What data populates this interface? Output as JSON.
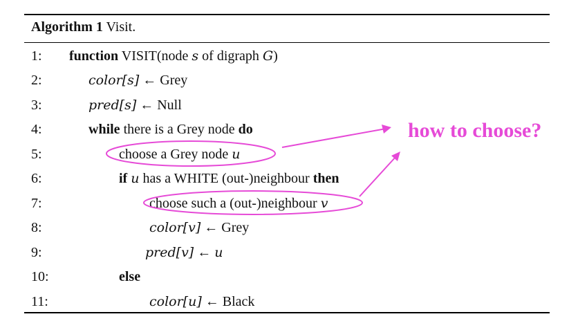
{
  "caption": {
    "label": "Algorithm 1",
    "title": "Visit."
  },
  "lines": [
    {
      "num": "1:",
      "parts": [
        {
          "t": "kw",
          "v": "function"
        },
        {
          "t": "txt",
          "v": " VISIT(node "
        },
        {
          "t": "math",
          "v": "s"
        },
        {
          "t": "txt",
          "v": " of digraph "
        },
        {
          "t": "math",
          "v": "G"
        },
        {
          "t": "txt",
          "v": ")"
        }
      ]
    },
    {
      "num": "2:",
      "parts": [
        {
          "t": "math",
          "v": "color[s]"
        },
        {
          "t": "txt",
          "v": " ← Grey"
        }
      ]
    },
    {
      "num": "3:",
      "parts": [
        {
          "t": "math",
          "v": "pred[s]"
        },
        {
          "t": "txt",
          "v": " ← Null"
        }
      ]
    },
    {
      "num": "4:",
      "parts": [
        {
          "t": "kw",
          "v": "while"
        },
        {
          "t": "txt",
          "v": " there is a Grey node "
        },
        {
          "t": "kw",
          "v": "do"
        }
      ]
    },
    {
      "num": "5:",
      "parts": [
        {
          "t": "txt",
          "v": "choose a Grey node "
        },
        {
          "t": "math",
          "v": "u"
        }
      ]
    },
    {
      "num": "6:",
      "parts": [
        {
          "t": "kw",
          "v": "if"
        },
        {
          "t": "txt",
          "v": " "
        },
        {
          "t": "math",
          "v": "u"
        },
        {
          "t": "txt",
          "v": " has a WHITE (out-)neighbour "
        },
        {
          "t": "kw",
          "v": "then"
        }
      ]
    },
    {
      "num": "7:",
      "parts": [
        {
          "t": "txt",
          "v": "choose such a (out-)neighbour "
        },
        {
          "t": "math",
          "v": "v"
        }
      ]
    },
    {
      "num": "8:",
      "parts": [
        {
          "t": "math",
          "v": "color[v]"
        },
        {
          "t": "txt",
          "v": " ← Grey"
        }
      ]
    },
    {
      "num": "9:",
      "parts": [
        {
          "t": "math",
          "v": "pred[v]"
        },
        {
          "t": "txt",
          "v": " ← "
        },
        {
          "t": "math",
          "v": "u"
        }
      ]
    },
    {
      "num": "10:",
      "parts": [
        {
          "t": "kw",
          "v": "else"
        }
      ]
    },
    {
      "num": "11:",
      "parts": [
        {
          "t": "math",
          "v": "color[u]"
        },
        {
          "t": "txt",
          "v": " ← Black"
        }
      ]
    }
  ],
  "annotation": {
    "text": "how to choose?",
    "color": "#e64ad7"
  }
}
